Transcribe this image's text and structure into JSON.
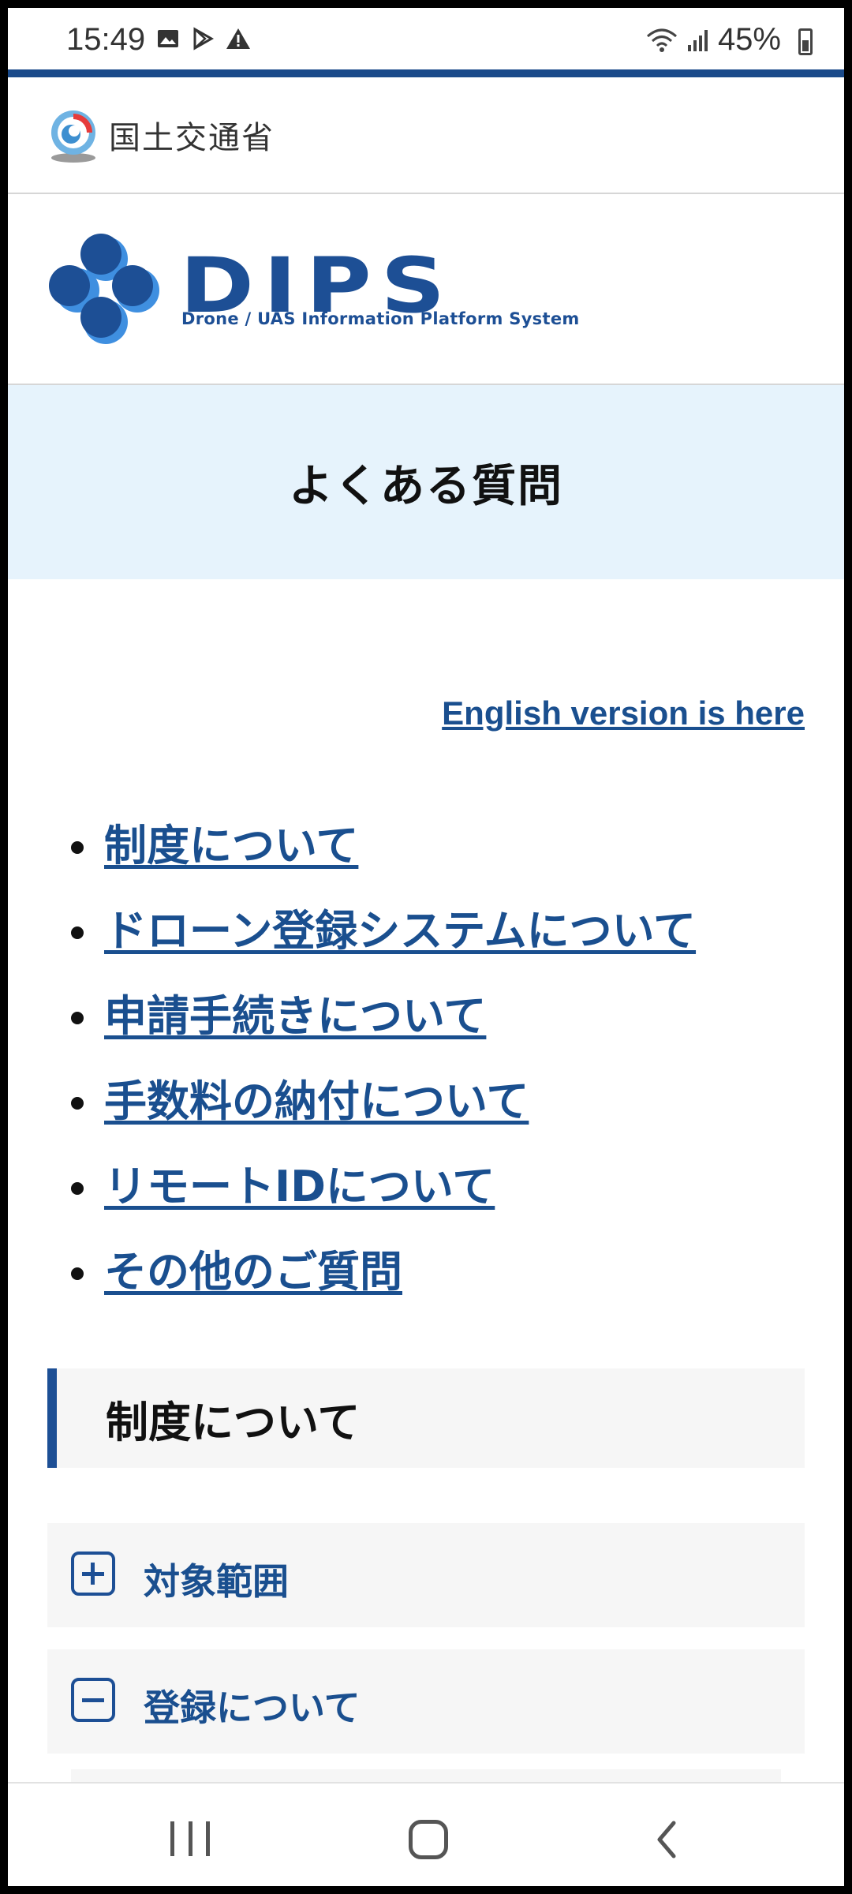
{
  "status_bar": {
    "time": "15:49",
    "battery": "45%",
    "icons": [
      "image-icon",
      "play-store-icon",
      "warning-icon",
      "wifi-icon",
      "signal-icon",
      "battery-icon"
    ]
  },
  "header": {
    "ministry_name": "国土交通省",
    "dips_logo_text": "DIPS",
    "dips_subtitle": "Drone / UAS Information Platform System"
  },
  "page": {
    "title": "よくある質問",
    "english_link": "English version is here"
  },
  "toc": {
    "items": [
      {
        "label": "制度について"
      },
      {
        "label": "ドローン登録システムについて"
      },
      {
        "label": "申請手続きについて"
      },
      {
        "label": "手数料の納付について"
      },
      {
        "label": "リモートIDについて"
      },
      {
        "label": "その他のご質問"
      }
    ]
  },
  "section": {
    "heading": "制度について",
    "accordions": [
      {
        "label": "対象範囲",
        "state": "collapsed",
        "icon": "plus-icon"
      },
      {
        "label": "登録について",
        "state": "expanded",
        "icon": "minus-icon"
      }
    ]
  },
  "colors": {
    "brand_blue": "#1d4f95",
    "link_blue": "#1a4f8f",
    "banner_bg": "#e6f3fc"
  }
}
